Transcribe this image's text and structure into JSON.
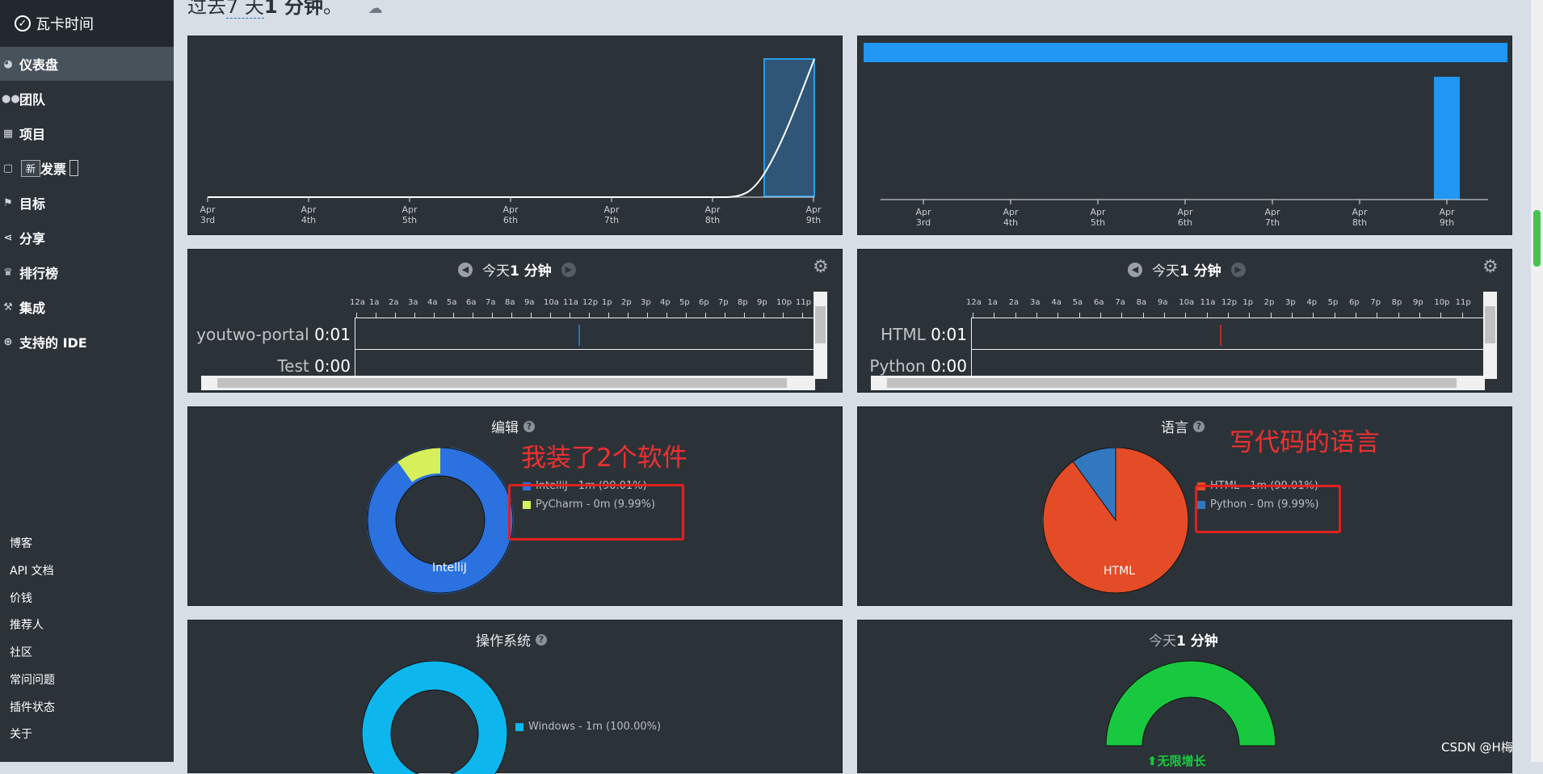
{
  "app": {
    "title": "瓦卡时间",
    "logo_icon": "check-circle-icon"
  },
  "sidebar": {
    "items": [
      {
        "icon": "dashboard-icon",
        "label": "仪表盘",
        "active": true
      },
      {
        "icon": "users-icon",
        "label": "团队"
      },
      {
        "icon": "grid-icon",
        "label": "项目"
      },
      {
        "icon": "document-icon",
        "label": "发票",
        "badge": "新"
      },
      {
        "icon": "flag-icon",
        "label": "目标"
      },
      {
        "icon": "share-icon",
        "label": "分享"
      },
      {
        "icon": "trophy-icon",
        "label": "排行榜"
      },
      {
        "icon": "wrench-icon",
        "label": "集成"
      },
      {
        "icon": "plus-circle-icon",
        "label": "支持的 IDE"
      }
    ],
    "footer_links": [
      "博客",
      "API 文档",
      "价钱",
      "推荐人",
      "社区",
      "常问问题",
      "插件状态",
      "关于"
    ]
  },
  "header": {
    "title_prefix": "过去",
    "title_days": "7 天",
    "title_time": "1 分钟",
    "title_suffix": "。"
  },
  "activity_chart": {
    "type": "line",
    "x_labels": [
      "Apr 3rd",
      "Apr 4th",
      "Apr 5th",
      "Apr 6th",
      "Apr 7th",
      "Apr 8th",
      "Apr 9th"
    ],
    "highlight": "Apr 9th",
    "line_color": "#ffffff",
    "highlight_color": "#2b9be8"
  },
  "daily_bar_chart": {
    "type": "bar",
    "x_labels": [
      "Apr 3rd",
      "Apr 4th",
      "Apr 5th",
      "Apr 6th",
      "Apr 7th",
      "Apr 8th",
      "Apr 9th"
    ],
    "bar_color": "#2196f3"
  },
  "project_timeline": {
    "prev_icon": "chevron-left-icon",
    "next_icon": "chevron-right-icon",
    "label_prefix": "今天",
    "label_time": "1 分钟",
    "hours": [
      "12a",
      "1a",
      "2a",
      "3a",
      "4a",
      "5a",
      "6a",
      "7a",
      "8a",
      "9a",
      "10a",
      "11a",
      "12p",
      "1p",
      "2p",
      "3p",
      "4p",
      "5p",
      "6p",
      "7p",
      "8p",
      "9p",
      "10p",
      "11p"
    ],
    "rows": [
      {
        "name": "youtwo-portal",
        "time": "0:01"
      },
      {
        "name": "Test",
        "time": "0:00"
      }
    ],
    "marker_color": "#2b6fb0"
  },
  "language_timeline": {
    "label_prefix": "今天",
    "label_time": "1 分钟",
    "hours": [
      "12a",
      "1a",
      "2a",
      "3a",
      "4a",
      "5a",
      "6a",
      "7a",
      "8a",
      "9a",
      "10a",
      "11a",
      "12p",
      "1p",
      "2p",
      "3p",
      "4p",
      "5p",
      "6p",
      "7p",
      "8p",
      "9p",
      "10p",
      "11p"
    ],
    "rows": [
      {
        "name": "HTML",
        "time": "0:01"
      },
      {
        "name": "Python",
        "time": "0:00"
      }
    ],
    "marker_color": "#b03030"
  },
  "editors": {
    "title": "编辑",
    "slice_label": "IntelliJ",
    "legend": [
      {
        "label": "IntelliJ - 1m (90.01%)",
        "color": "#2b72e0"
      },
      {
        "label": "PyCharm - 0m (9.99%)",
        "color": "#d7ef5a"
      }
    ],
    "annotation": "我装了2个软件"
  },
  "languages": {
    "title": "语言",
    "slice_label": "HTML",
    "legend": [
      {
        "label": "HTML - 1m (90.01%)",
        "color": "#e34c26"
      },
      {
        "label": "Python - 0m (9.99%)",
        "color": "#3178c0"
      }
    ],
    "annotation": "写代码的语言"
  },
  "os": {
    "title": "操作系统",
    "legend": [
      {
        "label": "Windows - 1m (100.00%)",
        "color": "#0db7ed"
      }
    ]
  },
  "goal": {
    "label_prefix": "今天",
    "label_time": "1 分钟",
    "gauge_color": "#18c940",
    "caption": "无限增长"
  },
  "chart_data": [
    {
      "type": "pie",
      "title": "编辑",
      "categories": [
        "IntelliJ",
        "PyCharm"
      ],
      "values": [
        90.01,
        9.99
      ]
    },
    {
      "type": "pie",
      "title": "语言",
      "categories": [
        "HTML",
        "Python"
      ],
      "values": [
        90.01,
        9.99
      ]
    },
    {
      "type": "pie",
      "title": "操作系统",
      "categories": [
        "Windows"
      ],
      "values": [
        100.0
      ]
    },
    {
      "type": "bar",
      "categories": [
        "Apr 3rd",
        "Apr 4th",
        "Apr 5th",
        "Apr 6th",
        "Apr 7th",
        "Apr 8th",
        "Apr 9th"
      ],
      "values": [
        0,
        0,
        0,
        0,
        0,
        0,
        1
      ]
    }
  ],
  "watermark": "CSDN @H梅"
}
